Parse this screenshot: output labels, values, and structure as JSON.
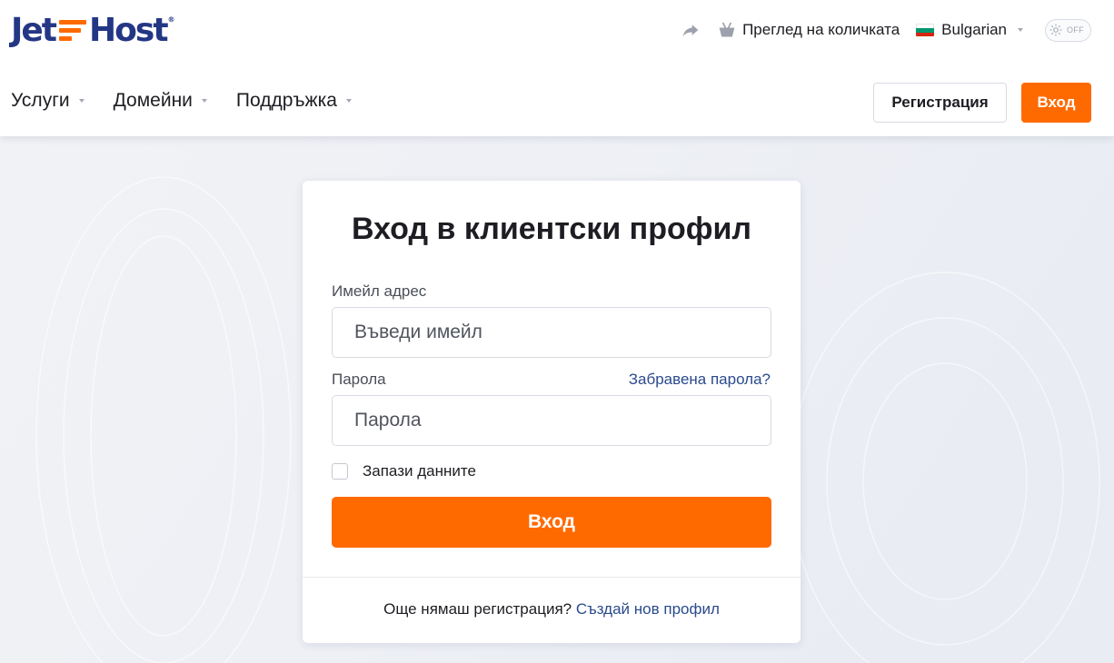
{
  "brand": {
    "name_left": "Jet",
    "name_right": "Host",
    "registered_mark": "®",
    "primary_color": "#ff6a00",
    "brand_blue": "#243785",
    "link_color": "#2a4a8c"
  },
  "topbar": {
    "share_icon": "share-arrow-icon",
    "cart_icon": "basket-icon",
    "cart_label": "Преглед на количката",
    "language": "Bulgarian",
    "language_flag": "bulgarian-flag",
    "theme_toggle_label": "OFF"
  },
  "nav": {
    "items": [
      {
        "label": "Услуги"
      },
      {
        "label": "Домейни"
      },
      {
        "label": "Поддръжка"
      }
    ],
    "register_label": "Регистрация",
    "login_label": "Вход"
  },
  "login": {
    "title": "Вход в клиентски профил",
    "email_label": "Имейл адрес",
    "email_placeholder": "Въведи имейл",
    "email_value": "",
    "password_label": "Парола",
    "password_placeholder": "Парола",
    "password_value": "",
    "forgot_label": "Забравена парола?",
    "remember_label": "Запази данните",
    "remember_checked": false,
    "submit_label": "Вход",
    "footer_text": "Още нямаш регистрация?",
    "footer_link": "Създай нов профил"
  }
}
